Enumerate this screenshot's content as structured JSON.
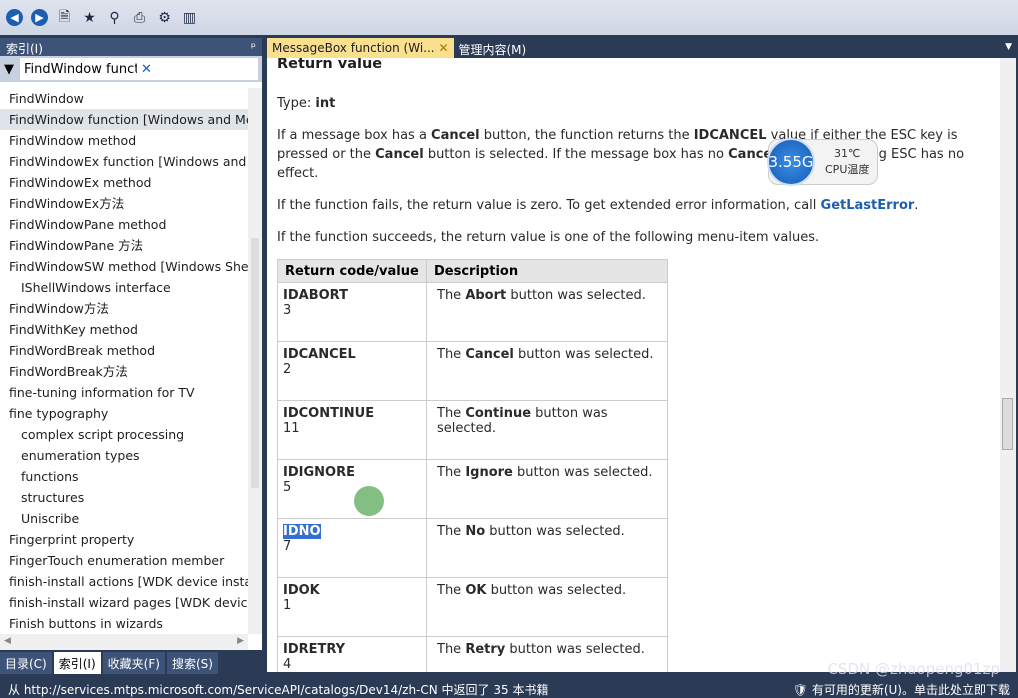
{
  "toolbar": {
    "icons": [
      "back-icon",
      "forward-icon",
      "sync-icon",
      "add-favorite-icon",
      "search-icon",
      "print-icon",
      "settings-icon",
      "library-icon"
    ]
  },
  "index": {
    "title": "索引(I)",
    "pin": "ᵖ",
    "filter_value": "FindWindow function [Windows and",
    "items": [
      {
        "label": "FindWindow",
        "indent": false
      },
      {
        "label": "FindWindow function [Windows and Me",
        "indent": false,
        "selected": true
      },
      {
        "label": "FindWindow method",
        "indent": false
      },
      {
        "label": "FindWindowEx function [Windows and M",
        "indent": false
      },
      {
        "label": "FindWindowEx method",
        "indent": false
      },
      {
        "label": "FindWindowEx方法",
        "indent": false
      },
      {
        "label": "FindWindowPane method",
        "indent": false
      },
      {
        "label": "FindWindowPane 方法",
        "indent": false
      },
      {
        "label": "FindWindowSW method [Windows Shell",
        "indent": false
      },
      {
        "label": "IShellWindows interface",
        "indent": true
      },
      {
        "label": "FindWindow方法",
        "indent": false
      },
      {
        "label": "FindWithKey method",
        "indent": false
      },
      {
        "label": "FindWordBreak method",
        "indent": false
      },
      {
        "label": "FindWordBreak方法",
        "indent": false
      },
      {
        "label": "fine-tuning information for TV",
        "indent": false
      },
      {
        "label": "fine typography",
        "indent": false
      },
      {
        "label": "complex script processing",
        "indent": true
      },
      {
        "label": "enumeration types",
        "indent": true
      },
      {
        "label": "functions",
        "indent": true
      },
      {
        "label": "structures",
        "indent": true
      },
      {
        "label": "Uniscribe",
        "indent": true
      },
      {
        "label": "Fingerprint property",
        "indent": false
      },
      {
        "label": "FingerTouch enumeration member",
        "indent": false
      },
      {
        "label": "finish-install actions [WDK device installa",
        "indent": false
      },
      {
        "label": "finish-install wizard pages [WDK device",
        "indent": false
      },
      {
        "label": "Finish buttons in wizards",
        "indent": false
      }
    ]
  },
  "bottom_tabs": [
    {
      "label": "目录(C)"
    },
    {
      "label": "索引(I)",
      "active": true
    },
    {
      "label": "收藏夹(F)"
    },
    {
      "label": "搜索(S)"
    }
  ],
  "tabs": [
    {
      "label": "MessageBox function (Wi...",
      "close": "✕",
      "active": true
    },
    {
      "label": "管理内容(M)"
    }
  ],
  "doc": {
    "heading": "Return value",
    "type_label": "Type: ",
    "type_value": "int",
    "p1": [
      "If a message box has a ",
      "Cancel",
      " button, the function returns the ",
      "IDCANCEL",
      " value if either the ESC key is pressed or the ",
      "Cancel",
      " button is selected. If the message box has no ",
      "Cancel",
      " button, pressing ESC has no effect."
    ],
    "p2_pre": "If the function fails, the return value is zero. To get extended error information, call ",
    "p2_link": "GetLastError",
    "p2_post": ".",
    "p3": "If the function succeeds, the return value is one of the following menu-item values.",
    "col1": "Return code/value",
    "col2": "Description",
    "rows": [
      {
        "code": "IDABORT",
        "value": "3",
        "pre": "The ",
        "btn": "Abort",
        "post": " button was selected."
      },
      {
        "code": "IDCANCEL",
        "value": "2",
        "pre": "The ",
        "btn": "Cancel",
        "post": " button was selected."
      },
      {
        "code": "IDCONTINUE",
        "value": "11",
        "pre": "The ",
        "btn": "Continue",
        "post": " button was selected."
      },
      {
        "code": "IDIGNORE",
        "value": "5",
        "pre": "The ",
        "btn": "Ignore",
        "post": " button was selected."
      },
      {
        "code": "IDNO",
        "value": "7",
        "pre": "The ",
        "btn": "No",
        "post": " button was selected.",
        "highlight": true
      },
      {
        "code": "IDOK",
        "value": "1",
        "pre": "The ",
        "btn": "OK",
        "post": " button was selected."
      },
      {
        "code": "IDRETRY",
        "value": "4",
        "pre": "The ",
        "btn": "Retry",
        "post": " button was selected."
      }
    ]
  },
  "widget": {
    "speed": "3.55G",
    "temp": "31℃",
    "label": "CPU温度"
  },
  "status": {
    "left": "从 http://services.mtps.microsoft.com/ServiceAPI/catalogs/Dev14/zh-CN 中返回了 35 本书籍",
    "right": "有可用的更新(U)。单击此处立即下载"
  },
  "watermark": "CSDN @zhaopeng01zp"
}
